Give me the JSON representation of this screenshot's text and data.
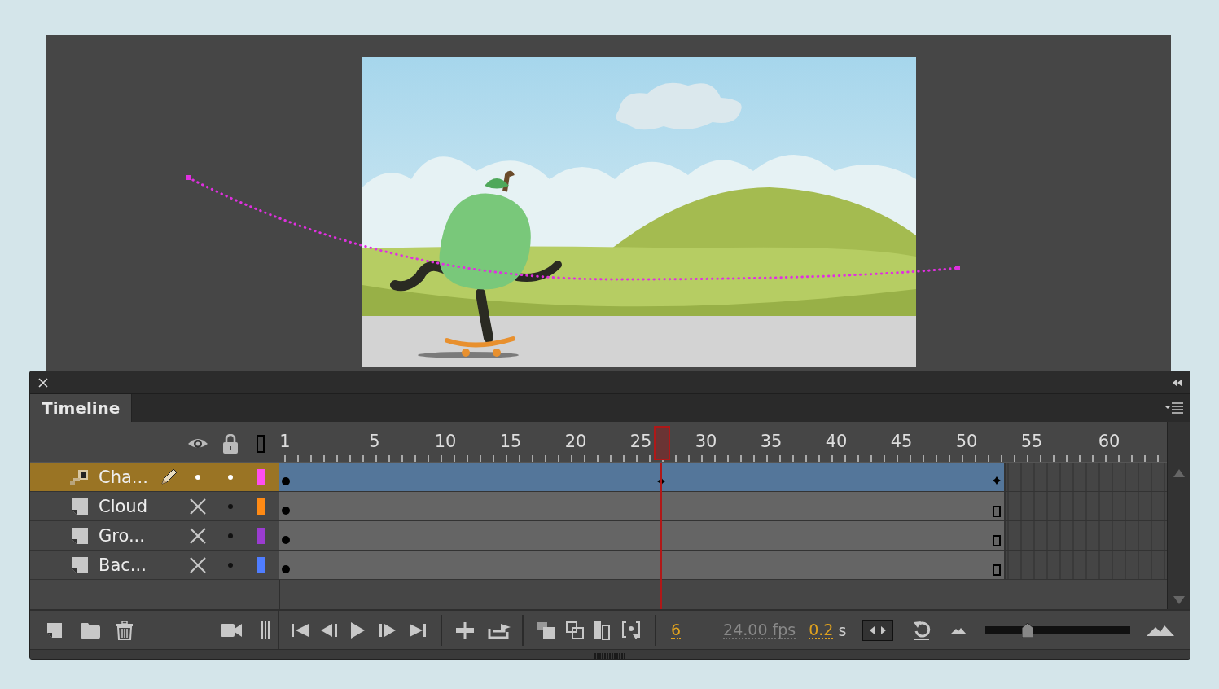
{
  "panel": {
    "title": "Timeline"
  },
  "ruler": {
    "labels": [
      "1",
      "5",
      "10",
      "15",
      "20",
      "25",
      "30",
      "35",
      "40",
      "45",
      "50",
      "55",
      "60"
    ]
  },
  "layers": [
    {
      "name": "Cha...",
      "kind": "motion",
      "selected": true,
      "editing": true,
      "hidden": false,
      "locked": false,
      "color": "#ff4ef0"
    },
    {
      "name": "Cloud",
      "kind": "normal",
      "selected": false,
      "editing": false,
      "hidden": true,
      "locked": false,
      "color": "#ff8a14"
    },
    {
      "name": "Gro...",
      "kind": "normal",
      "selected": false,
      "editing": false,
      "hidden": true,
      "locked": false,
      "color": "#9b3cd0"
    },
    {
      "name": "Bac...",
      "kind": "normal",
      "selected": false,
      "editing": false,
      "hidden": true,
      "locked": false,
      "color": "#4f7dff"
    }
  ],
  "playback": {
    "current_frame": "6",
    "frame_rate": "24.00 fps",
    "elapsed": "0.2",
    "elapsed_unit": "s",
    "span_toggle": {
      "on": true
    },
    "zoom": {
      "level": 0.29
    }
  }
}
